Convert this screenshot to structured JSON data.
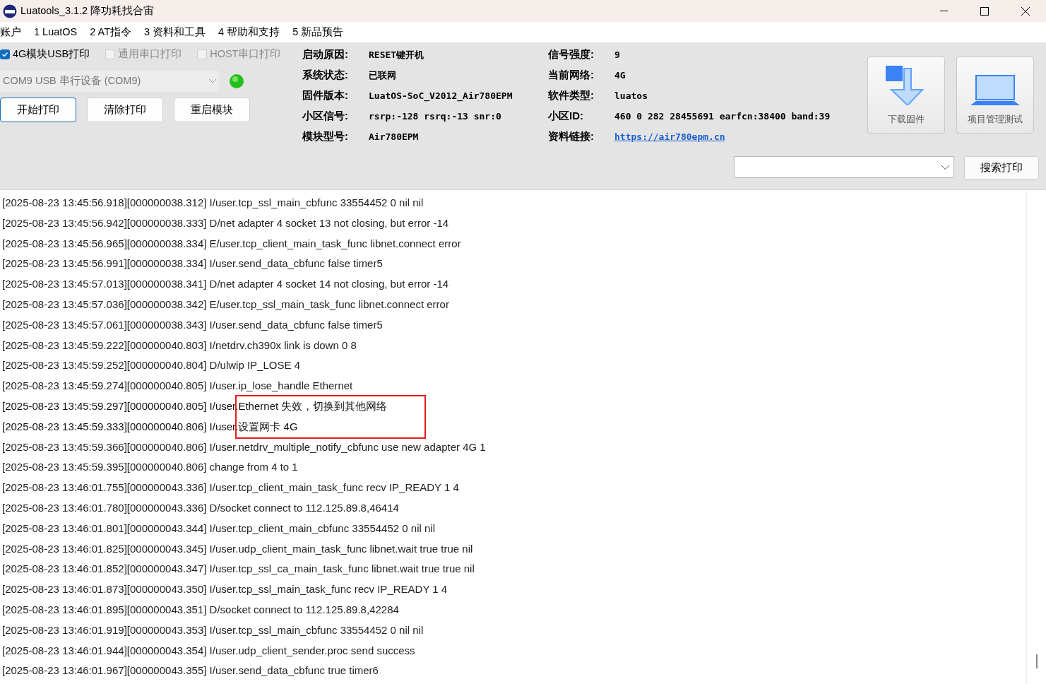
{
  "window": {
    "title": "Luatools_3.1.2 降功耗找合宙"
  },
  "menu": [
    "账户",
    "1 LuatOS",
    "2 AT指令",
    "3 资料和工具",
    "4 帮助和支持",
    "5 新品预告"
  ],
  "print_options": [
    {
      "label": "4G模块USB打印",
      "checked": true,
      "disabled": false
    },
    {
      "label": "通用串口打印",
      "checked": false,
      "disabled": true
    },
    {
      "label": "HOST串口打印",
      "checked": false,
      "disabled": true
    }
  ],
  "port": {
    "value": "COM9 USB 串行设备 (COM9)",
    "connected": true,
    "disabled": true
  },
  "buttons": [
    {
      "label": "开始打印",
      "selected": true
    },
    {
      "label": "清除打印",
      "selected": false
    },
    {
      "label": "重启模块",
      "selected": false
    }
  ],
  "info_left": [
    {
      "label": "启动原因:",
      "value": "RESET键开机",
      "kind": "text"
    },
    {
      "label": "系统状态:",
      "value": "已联网",
      "kind": "text"
    },
    {
      "label": "固件版本:",
      "value": "LuatOS-SoC_V2012_Air780EPM",
      "kind": "text"
    },
    {
      "label": "小区信号:",
      "value": "rsrp:-128 rsrq:-13 snr:0",
      "kind": "text"
    },
    {
      "label": "模块型号:",
      "value": "Air780EPM",
      "kind": "text"
    }
  ],
  "info_right": [
    {
      "label": "信号强度:",
      "value": "9",
      "kind": "text"
    },
    {
      "label": "当前网络:",
      "value": "4G",
      "kind": "text"
    },
    {
      "label": "软件类型:",
      "value": "luatos",
      "kind": "text"
    },
    {
      "label": "小区ID:",
      "value": "460 0 282 28455691 earfcn:38400 band:39",
      "kind": "text"
    },
    {
      "label": "资料链接:",
      "value": "https://air780epm.cn",
      "kind": "link"
    }
  ],
  "tool_buttons": [
    {
      "label": "下载固件",
      "kind": "download"
    },
    {
      "label": "项目管理测试",
      "kind": "laptop"
    }
  ],
  "search_button": "搜索打印",
  "log": [
    {
      "text": "[2025-08-23 13:45:56.918][000000038.312] I/user.tcp_ssl_main_cbfunc 33554452 0 nil nil",
      "highlighted": false
    },
    {
      "text": "[2025-08-23 13:45:56.942][000000038.333] D/net adapter 4 socket 13 not closing, but error -14",
      "highlighted": false
    },
    {
      "text": "[2025-08-23 13:45:56.965][000000038.334] E/user.tcp_client_main_task_func libnet.connect error",
      "highlighted": false
    },
    {
      "text": "[2025-08-23 13:45:56.991][000000038.334] I/user.send_data_cbfunc false timer5",
      "highlighted": false
    },
    {
      "text": "[2025-08-23 13:45:57.013][000000038.341] D/net adapter 4 socket 14 not closing, but error -14",
      "highlighted": false
    },
    {
      "text": "[2025-08-23 13:45:57.036][000000038.342] E/user.tcp_ssl_main_task_func libnet.connect error",
      "highlighted": false
    },
    {
      "text": "[2025-08-23 13:45:57.061][000000038.343] I/user.send_data_cbfunc false timer5",
      "highlighted": false
    },
    {
      "text": "[2025-08-23 13:45:59.222][000000040.803] I/netdrv.ch390x link is down 0 8",
      "highlighted": false
    },
    {
      "text": "[2025-08-23 13:45:59.252][000000040.804] D/ulwip IP_LOSE 4",
      "highlighted": false
    },
    {
      "text": "[2025-08-23 13:45:59.274][000000040.805] I/user.ip_lose_handle Ethernet",
      "highlighted": false
    },
    {
      "text": "[2025-08-23 13:45:59.297][000000040.805] I/user.Ethernet 失效，切换到其他网络",
      "highlighted": true
    },
    {
      "text": "[2025-08-23 13:45:59.333][000000040.806] I/user.设置网卡 4G",
      "highlighted": true
    },
    {
      "text": "[2025-08-23 13:45:59.366][000000040.806] I/user.netdrv_multiple_notify_cbfunc use new adapter 4G 1",
      "highlighted": false
    },
    {
      "text": "[2025-08-23 13:45:59.395][000000040.806] change from 4 to 1",
      "highlighted": false
    },
    {
      "text": "[2025-08-23 13:46:01.755][000000043.336] I/user.tcp_client_main_task_func recv IP_READY 1 4",
      "highlighted": false
    },
    {
      "text": "[2025-08-23 13:46:01.780][000000043.336] D/socket connect to 112.125.89.8,46414",
      "highlighted": false
    },
    {
      "text": "[2025-08-23 13:46:01.801][000000043.344] I/user.tcp_client_main_cbfunc 33554452 0 nil nil",
      "highlighted": false
    },
    {
      "text": "[2025-08-23 13:46:01.825][000000043.345] I/user.udp_client_main_task_func libnet.wait true true nil",
      "highlighted": false
    },
    {
      "text": "[2025-08-23 13:46:01.852][000000043.347] I/user.tcp_ssl_ca_main_task_func libnet.wait true true nil",
      "highlighted": false
    },
    {
      "text": "[2025-08-23 13:46:01.873][000000043.350] I/user.tcp_ssl_main_task_func recv IP_READY 1 4",
      "highlighted": false
    },
    {
      "text": "[2025-08-23 13:46:01.895][000000043.351] D/socket connect to 112.125.89.8,42284",
      "highlighted": false
    },
    {
      "text": "[2025-08-23 13:46:01.919][000000043.353] I/user.tcp_ssl_main_cbfunc 33554452 0 nil nil",
      "highlighted": false
    },
    {
      "text": "[2025-08-23 13:46:01.944][000000043.354] I/user.udp_client_sender.proc send success",
      "highlighted": false
    },
    {
      "text": "[2025-08-23 13:46:01.967][000000043.355] I/user.send_data_cbfunc true timer6",
      "highlighted": false
    }
  ]
}
